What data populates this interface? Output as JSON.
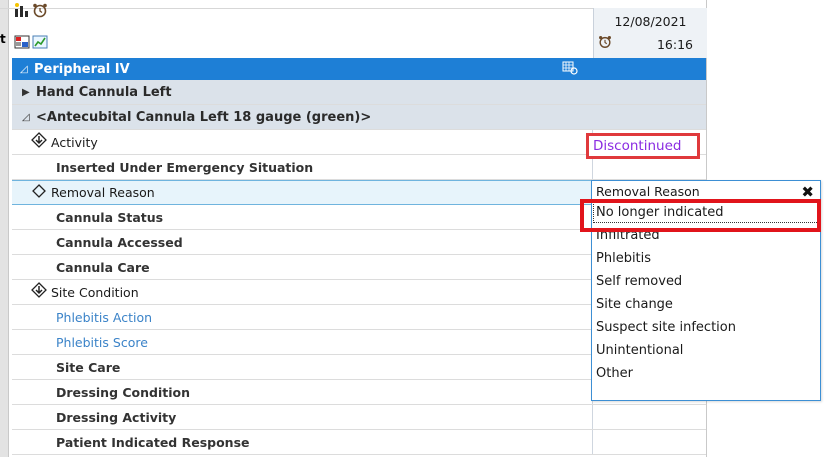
{
  "toolbar": {
    "icons": [
      "chart-bars-icon",
      "alarm-clock-icon",
      "flag-grid-icon",
      "trend-chart-icon"
    ],
    "cut_letter": "t"
  },
  "header_column": {
    "date": "12/08/2021",
    "time": "16:16",
    "clock_icon": "alarm-clock-icon"
  },
  "section": {
    "title": "Peripheral IV",
    "icon": "grid-sync-icon"
  },
  "groups": [
    {
      "label": "Hand Cannula Left",
      "expanded": false
    },
    {
      "label": "<Antecubital Cannula Left 18 gauge (green)>",
      "expanded": true
    }
  ],
  "rows": [
    {
      "label": "Activity",
      "marker": "diamond-arrow",
      "value": "Discontinued"
    },
    {
      "label": "Inserted Under Emergency Situation"
    },
    {
      "label": "Removal Reason",
      "marker": "diamond"
    },
    {
      "label": "Cannula Status"
    },
    {
      "label": "Cannula Accessed"
    },
    {
      "label": "Cannula Care"
    },
    {
      "label": "Site Condition",
      "marker": "diamond-arrow"
    },
    {
      "label": "Phlebitis Action"
    },
    {
      "label": "Phlebitis Score"
    },
    {
      "label": "Site Care"
    },
    {
      "label": "Dressing Condition"
    },
    {
      "label": "Dressing Activity"
    },
    {
      "label": "Patient Indicated Response"
    }
  ],
  "popup": {
    "title": "Removal Reason",
    "close_label": "✖",
    "options": [
      "No longer indicated",
      "Infiltrated",
      "Phlebitis",
      "Self removed",
      "Site change",
      "Suspect site infection",
      "Unintentional",
      "Other"
    ],
    "highlighted_option": "No longer indicated"
  },
  "colors": {
    "section_header": "#1e7fd6",
    "subgroup": "#dbe2ea",
    "link_text": "#3b83c8",
    "discontinued_text": "#8a2be2",
    "annotation_red": "#e1141b"
  }
}
